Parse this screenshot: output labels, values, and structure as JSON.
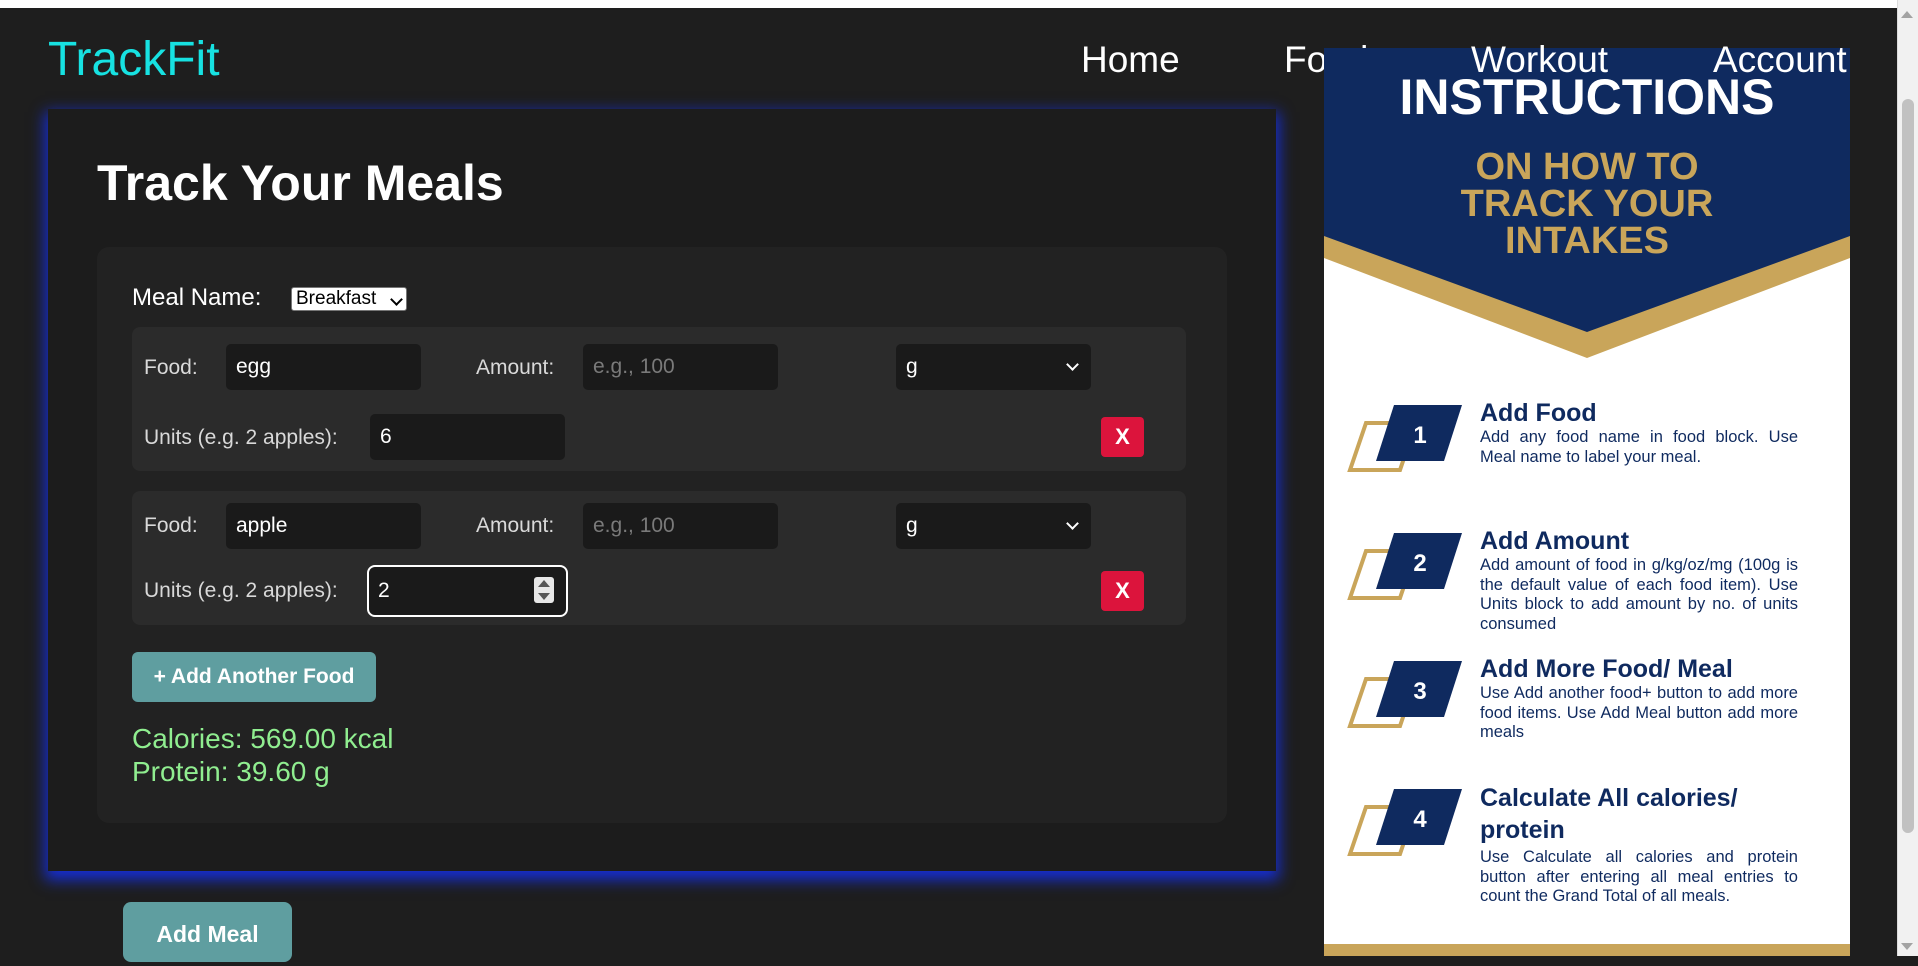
{
  "app": {
    "logo": "TrackFit"
  },
  "nav": {
    "home": "Home",
    "food": "Food",
    "workout": "Workout",
    "account": "Account"
  },
  "page": {
    "title": "Track Your Meals"
  },
  "meal": {
    "label": "Meal Name:",
    "selected": "Breakfast"
  },
  "entries": [
    {
      "food_label": "Food:",
      "food_value": "egg",
      "amount_label": "Amount:",
      "amount_placeholder": "e.g., 100",
      "unit": "g",
      "units_label": "Units (e.g. 2 apples):",
      "units_value": "6",
      "remove": "X"
    },
    {
      "food_label": "Food:",
      "food_value": "apple",
      "amount_label": "Amount:",
      "amount_placeholder": "e.g., 100",
      "unit": "g",
      "units_label": "Units (e.g. 2 apples):",
      "units_value": "2",
      "remove": "X"
    }
  ],
  "buttons": {
    "add_food": "+ Add Another Food",
    "add_meal": "Add Meal"
  },
  "totals": {
    "calories": "Calories: 569.00 kcal",
    "protein": "Protein: 39.60 g"
  },
  "instructions": {
    "heading": "INSTRUCTIONS",
    "subheading": [
      "ON HOW TO",
      "TRACK YOUR",
      "INTAKES"
    ],
    "steps": [
      {
        "num": "1",
        "title": "Add Food",
        "body": "Add any food name in food block. Use Meal name to label your meal."
      },
      {
        "num": "2",
        "title": "Add Amount",
        "body": "Add amount of food in g/kg/oz/mg (100g is the default value of each food item). Use Units block to add amount by no. of units consumed"
      },
      {
        "num": "3",
        "title": "Add More Food/ Meal",
        "body": "Use Add another food+ button to add more food items. Use Add Meal button add more meals"
      },
      {
        "num": "4",
        "title": "Calculate All calories/ protein",
        "body": "Use Calculate all calories and protein button after entering all meal entries to count the Grand Total of all meals."
      }
    ]
  },
  "colors": {
    "logo": "#17e2e2",
    "navy": "#0f2a5f",
    "gold": "#c9a55a",
    "panel_glow": "#1432ff",
    "teal_button": "#5f9ea0",
    "remove_button": "#dc143c",
    "totals_text": "#90ee90"
  },
  "icons": {
    "dropdown": "chevron-down-icon",
    "number_stepper": "stepper-icon"
  }
}
